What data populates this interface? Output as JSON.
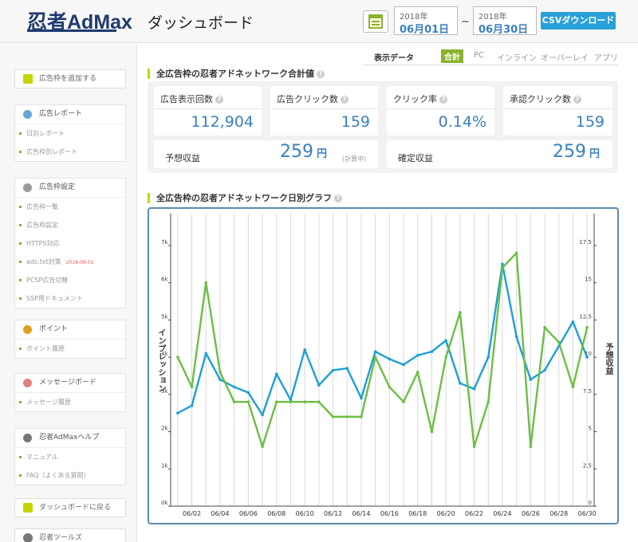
{
  "header": {
    "logo": "忍者AdMax",
    "title": "ダッシュボード",
    "date_from": {
      "year": "2018年",
      "md": "06月01日"
    },
    "date_to": {
      "year": "2018年",
      "md": "06月30日"
    },
    "tilde": "~",
    "csv_button": "CSVダウンロード"
  },
  "tabs": {
    "label": "表示データ",
    "items": [
      "合計",
      "PC",
      "インライン",
      "オーバーレイ",
      "アプリ"
    ],
    "active": "合計"
  },
  "sidebar": {
    "add_button": "広告枠を追加する",
    "groups": [
      {
        "title": "広告レポート",
        "color": "#6aa6d6",
        "items": [
          "日別レポート",
          "広告枠別レポート"
        ]
      },
      {
        "title": "広告枠設定",
        "color": "#999999",
        "items": [
          "広告枠一覧",
          "広告枠設定",
          "HTTPS対応",
          "ads.txt対策",
          "PCSP広告切替",
          "SSP用ドキュメント"
        ],
        "new_badge": "2018-06-01"
      },
      {
        "title": "ポイント",
        "color": "#e0a020",
        "items": [
          "ポイント履歴"
        ]
      },
      {
        "title": "メッセージボード",
        "color": "#e08080",
        "items": [
          "メッセージ履歴"
        ]
      },
      {
        "title": "忍者AdMaxヘルプ",
        "color": "#777777",
        "items": [
          "マニュアル",
          "FAQ（よくある質問）"
        ]
      }
    ],
    "dashboard_button": "ダッシュボードに戻る",
    "footer_title": "忍者ツールズ"
  },
  "summary": {
    "title": "全広告枠の忍者アドネットワーク合計値",
    "cards": [
      {
        "label": "広告表示回数",
        "value": "112,904"
      },
      {
        "label": "広告クリック数",
        "value": "159"
      },
      {
        "label": "クリック率",
        "value": "0.14%"
      },
      {
        "label": "承認クリック数",
        "value": "159"
      }
    ],
    "estimated": {
      "label": "予想収益",
      "value": "259",
      "unit": "円",
      "note": "(計算中)"
    },
    "confirmed": {
      "label": "確定収益",
      "value": "259",
      "unit": "円"
    }
  },
  "chart_title": "全広告枠の忍者アドネットワーク日別グラフ",
  "chart_data": {
    "type": "line",
    "x": [
      "06/01",
      "06/02",
      "06/03",
      "06/04",
      "06/05",
      "06/06",
      "06/07",
      "06/08",
      "06/09",
      "06/10",
      "06/11",
      "06/12",
      "06/13",
      "06/14",
      "06/15",
      "06/16",
      "06/17",
      "06/18",
      "06/19",
      "06/20",
      "06/21",
      "06/22",
      "06/23",
      "06/24",
      "06/25",
      "06/26",
      "06/27",
      "06/28",
      "06/29",
      "06/30"
    ],
    "x_tick_labels": [
      "06/02",
      "06/04",
      "06/06",
      "06/08",
      "06/10",
      "06/12",
      "06/14",
      "06/16",
      "06/18",
      "06/20",
      "06/22",
      "06/24",
      "06/26",
      "06/28",
      "06/30"
    ],
    "series": [
      {
        "name": "インプレッション",
        "axis": "left",
        "color": "#1e9fd6",
        "values": [
          2500,
          2700,
          4100,
          3400,
          3200,
          3050,
          2450,
          3550,
          2850,
          4200,
          3250,
          3650,
          3700,
          2900,
          4150,
          3950,
          3800,
          4050,
          4150,
          4450,
          3300,
          3150,
          4000,
          6500,
          4550,
          3400,
          3650,
          4300,
          4950,
          4000
        ]
      },
      {
        "name": "予想収益",
        "axis": "right",
        "color": "#6cbe45",
        "values": [
          10,
          8,
          15,
          9,
          7,
          7,
          4,
          7,
          7,
          7,
          7,
          6,
          6,
          6,
          10,
          8,
          7,
          9,
          5,
          10,
          13,
          4,
          7,
          16,
          17,
          4,
          12,
          11,
          8,
          12
        ]
      }
    ],
    "ylabel_left": "インプレッション",
    "ylabel_right": "予想収益",
    "y_left_ticks": [
      "0k",
      "1k",
      "2k",
      "3k",
      "4k",
      "5k",
      "6k",
      "7k"
    ],
    "y_right_ticks": [
      "0",
      "2.5",
      "5",
      "7.5",
      "10",
      "12.5",
      "15",
      "17.5"
    ],
    "ylim_left": [
      0,
      7000
    ],
    "ylim_right": [
      0,
      17.5
    ],
    "grid": true
  }
}
